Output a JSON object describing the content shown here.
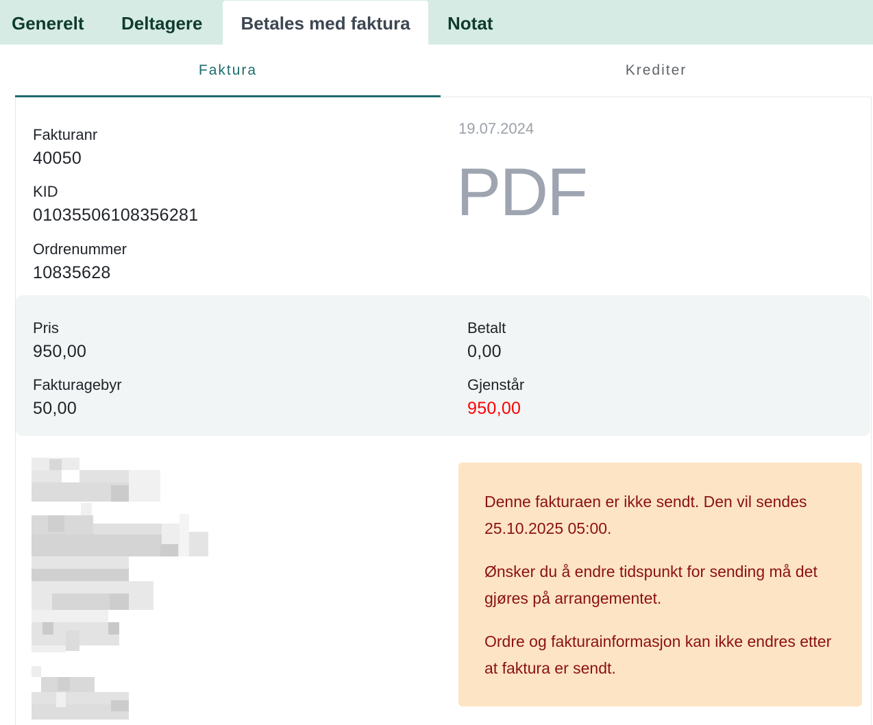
{
  "tabs": [
    "Generelt",
    "Deltagere",
    "Betales med faktura",
    "Notat"
  ],
  "active_tab": "Betales med faktura",
  "subtabs": [
    "Faktura",
    "Krediter"
  ],
  "active_subtab": "Faktura",
  "invoice": {
    "number_label": "Fakturanr",
    "number": "40050",
    "kid_label": "KID",
    "kid": "01035506108356281",
    "order_label": "Ordrenummer",
    "order": "10835628",
    "date": "19.07.2024",
    "pdf_label": "PDF"
  },
  "summary": {
    "price_label": "Pris",
    "price": "950,00",
    "fee_label": "Fakturagebyr",
    "fee": "50,00",
    "paid_label": "Betalt",
    "paid": "0,00",
    "remaining_label": "Gjenstår",
    "remaining": "950,00",
    "remaining_color": "#ff0000"
  },
  "notice": {
    "paragraphs": [
      "Denne fakturaen er ikke sendt. Den vil sendes 25.10.2025 05:00.",
      "Ønsker du å endre tidspunkt for sending må det gjøres på arrangementet.",
      "Ordre og fakturainformasjon kan ikke endres etter at faktura er sendt."
    ],
    "background": "#fde4c5",
    "text_color": "#8a1111"
  },
  "colors": {
    "tabbar": "#d6ebe4",
    "accent": "#1d6b6b"
  }
}
